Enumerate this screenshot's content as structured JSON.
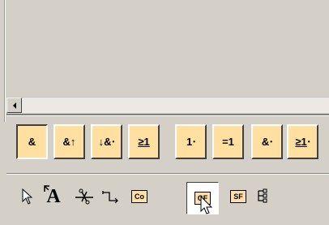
{
  "gate_palette": {
    "buttons": [
      {
        "label": "&",
        "sub": "",
        "state": "pressed"
      },
      {
        "label": "&↑",
        "sub": "",
        "state": "normal"
      },
      {
        "label": "↓&",
        "sub": "•",
        "state": "normal"
      },
      {
        "label": "≥1",
        "sub": "",
        "state": "normal"
      },
      {
        "label": "1",
        "sub": "•",
        "state": "normal"
      },
      {
        "label": "=1",
        "sub": "",
        "state": "normal"
      },
      {
        "label": "&",
        "sub": "•",
        "state": "normal"
      },
      {
        "label": "≥1",
        "sub": "•",
        "state": "normal"
      }
    ]
  },
  "tools": [
    {
      "icon": "select-arrow-icon",
      "label": ""
    },
    {
      "icon": "text-tool-icon",
      "label": "A"
    },
    {
      "icon": "cut-connection-icon",
      "label": ""
    },
    {
      "icon": "connector-icon",
      "label": ""
    },
    {
      "icon": "co-block-icon",
      "label": "Co"
    },
    {
      "icon": "gf-block-icon",
      "label": "GF"
    },
    {
      "icon": "sf-block-icon",
      "label": "SF"
    },
    {
      "icon": "terminal-icon",
      "label": ""
    }
  ],
  "colors": {
    "button_fill": "#ffe0a0",
    "panel_bg": "#d4d0c8"
  }
}
